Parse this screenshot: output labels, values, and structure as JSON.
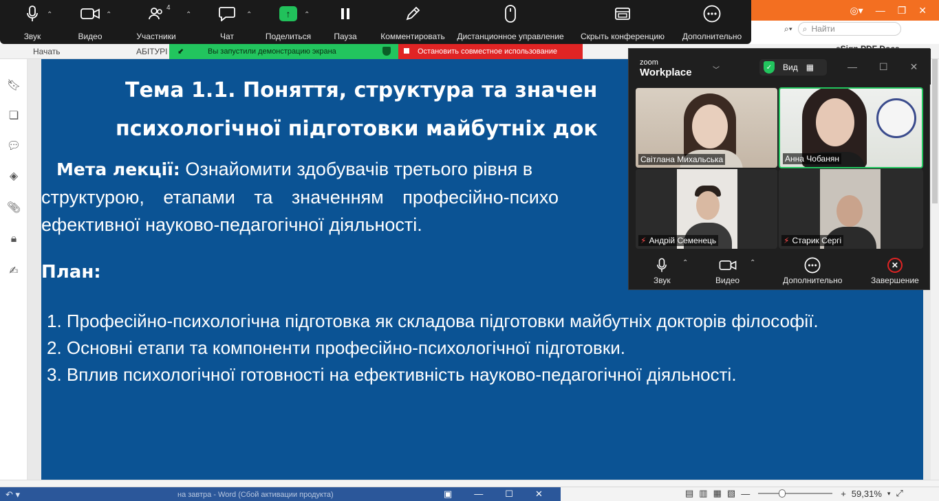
{
  "pdf_viewer": {
    "tabs": {
      "start": "Начать",
      "abit": "АБІТУРІ",
      "esign": "eSign PDF Docs"
    },
    "search_placeholder": "Найти",
    "zoom_level": "59,31%"
  },
  "slide": {
    "title_line1": "Тема 1.1.  Поняття, структура та значен",
    "title_line2": "психологічної підготовки майбутніх док",
    "goal_label": "Мета лекції:",
    "goal_line1": " Ознайомити здобувачів третього рівня в",
    "goal_line2": "структурою, етапами та значенням професійно-психо",
    "goal_line3": "ефективної науково-педагогічної діяльності.",
    "plan_heading": "План:",
    "plan_items": [
      "1. Професійно-психологічна підготовка як складова підготовки майбутніх докторів філософії.",
      "2. Основні етапи та компоненти професійно-психологічної підготовки.",
      "3. Вплив психологічної готовності на ефективність науково-педагогічної діяльності."
    ]
  },
  "zoom_toolbar": {
    "audio": "Звук",
    "video": "Видео",
    "participants": "Участники",
    "participants_count": "4",
    "chat": "Чат",
    "share": "Поделиться",
    "pause": "Пауза",
    "annotate": "Комментировать",
    "remote_control": "Дистанционное управление",
    "hide_meeting": "Скрыть конференцию",
    "more": "Дополнительно"
  },
  "share_banner": {
    "notice": "Вы запустили демонстрацию экрана",
    "stop": "Остановить совместное использование"
  },
  "zoom_window": {
    "logo_small": "zoom",
    "logo_big": "Workplace",
    "view_label": "Вид",
    "participants": [
      {
        "name": "Світлана Михальська",
        "muted": false
      },
      {
        "name": "Анна Чобанян",
        "muted": false,
        "active_speaker": true
      },
      {
        "name": "Андрій Семенець",
        "muted": true
      },
      {
        "name": "Старик Сергі",
        "muted": true
      }
    ],
    "footer": {
      "audio": "Звук",
      "video": "Видео",
      "more": "Дополнительно",
      "end": "Завершение"
    },
    "colors": {
      "active_border": "#22c55e",
      "end_red": "#e02424"
    }
  },
  "taskbar": {
    "word_title": "на завтра - Word (Сбой активации продукта)"
  },
  "colors": {
    "slide_bg": "#0b5394",
    "app_orange": "#f36f21",
    "share_green": "#22c55e",
    "stop_red": "#e02424"
  }
}
